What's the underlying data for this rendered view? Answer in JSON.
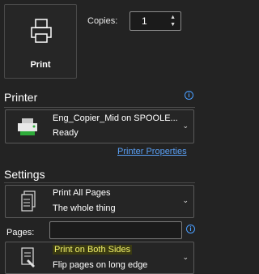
{
  "print_button": {
    "label": "Print"
  },
  "copies": {
    "label": "Copies:",
    "value": "1"
  },
  "printer": {
    "section_title": "Printer",
    "name": "Eng_Copier_Mid on SPOOLE...",
    "status": "Ready",
    "properties_link": "Printer Properties"
  },
  "settings": {
    "section_title": "Settings",
    "print_range": {
      "title": "Print All Pages",
      "subtitle": "The whole thing"
    },
    "pages": {
      "label": "Pages:",
      "value": ""
    },
    "duplex": {
      "title": "Print on Both Sides",
      "subtitle": "Flip pages on long edge"
    }
  },
  "icons": {
    "print": "printer-icon",
    "info": "info-icon",
    "printer_device": "printer-device-icon",
    "pages": "pages-icon",
    "duplex": "duplex-icon",
    "chevron": "chevron-down-icon"
  },
  "colors": {
    "background": "#232323",
    "accent_link": "#5aa0f5",
    "highlight_text": "#f3f36a"
  }
}
